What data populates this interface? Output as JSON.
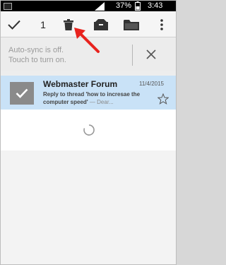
{
  "status_bar": {
    "battery_percent": "37%",
    "time": "3:43 PM",
    "icons": [
      "notification-square-icon",
      "signal-icon",
      "battery-icon"
    ]
  },
  "action_bar": {
    "selected_count": "1",
    "icons": [
      "checkmark-icon",
      "trash-icon",
      "archive-icon",
      "folder-icon",
      "overflow-menu-icon"
    ]
  },
  "banner": {
    "line1": "Auto-sync is off.",
    "line2": "Touch to turn on.",
    "close_icon": "close-icon"
  },
  "conversation": {
    "sender": "Webmaster Forum",
    "date": "11/4/2015",
    "subject": "Reply to thread 'how to incresae the computer speed'",
    "preview": " — Dear...",
    "selected_color": "#c9e2f7",
    "star_icon": "star-outline-icon"
  },
  "loading": {
    "spinner_icon": "loading-spinner-icon"
  },
  "annotation": {
    "arrow_color": "#e8231e"
  }
}
